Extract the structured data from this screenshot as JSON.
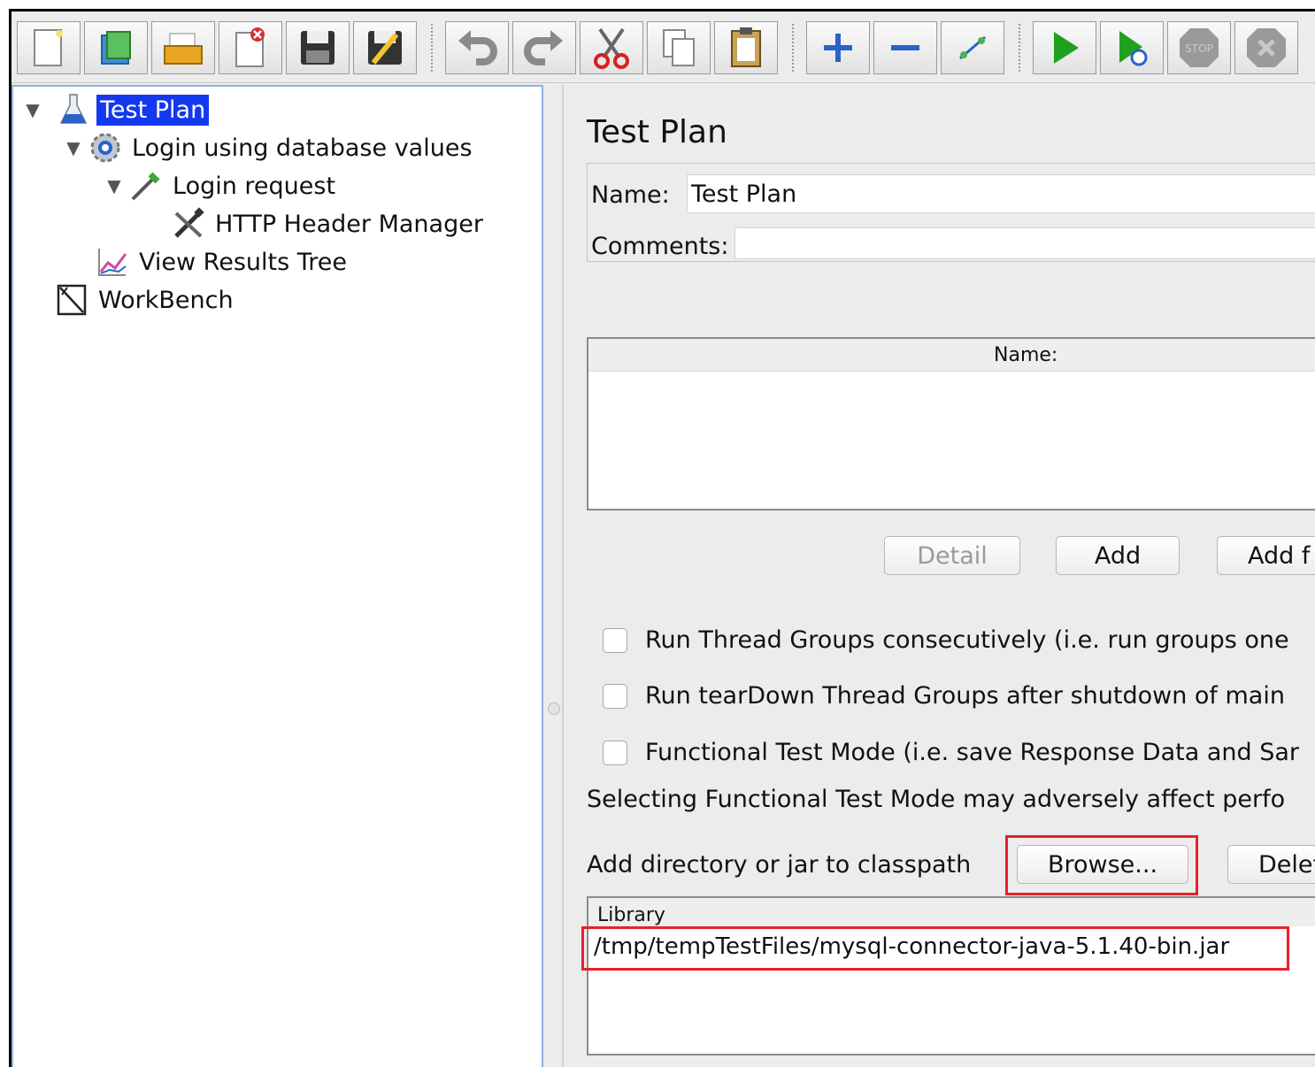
{
  "toolbar": {
    "groups": [
      [
        "new-icon",
        "templates-icon",
        "open-icon",
        "close-icon",
        "save-icon",
        "save-as-icon"
      ],
      [
        "undo-icon",
        "redo-icon",
        "cut-icon",
        "copy-icon",
        "paste-icon"
      ],
      [
        "expand-icon",
        "collapse-icon",
        "toggle-icon"
      ],
      [
        "start-icon",
        "start-no-pauses-icon",
        "stop-icon",
        "shutdown-icon"
      ]
    ]
  },
  "tree": {
    "items": [
      {
        "label": "Test Plan",
        "icon": "flask-icon",
        "expanded": true,
        "selected": true
      },
      {
        "label": "Login using database values",
        "icon": "gear-icon",
        "expanded": true
      },
      {
        "label": "Login request",
        "icon": "pipette-icon",
        "expanded": true
      },
      {
        "label": "HTTP Header Manager",
        "icon": "tools-icon"
      },
      {
        "label": "View Results Tree",
        "icon": "graph-icon"
      },
      {
        "label": "WorkBench",
        "icon": "workbench-icon"
      }
    ]
  },
  "panel": {
    "title": "Test Plan",
    "name_label": "Name:",
    "name_value": "Test Plan",
    "comments_label": "Comments:",
    "comments_value": "",
    "variables_header": "Name:",
    "buttons": {
      "detail": "Detail",
      "add": "Add",
      "add_from_clipboard": "Add f"
    },
    "checkboxes": [
      {
        "label": "Run Thread Groups consecutively (i.e. run groups one",
        "checked": false
      },
      {
        "label": "Run tearDown Thread Groups after shutdown of main",
        "checked": false
      },
      {
        "label": "Functional Test Mode (i.e. save Response Data and Sar",
        "checked": false
      }
    ],
    "functional_warning": "Selecting Functional Test Mode may adversely affect perfo",
    "classpath_label": "Add directory or jar to classpath",
    "browse_button": "Browse...",
    "delete_button": "Delet",
    "library_header": "Library",
    "library_rows": [
      "/tmp/tempTestFiles/mysql-connector-java-5.1.40-bin.jar"
    ]
  },
  "colors": {
    "selection": "#1338f0",
    "highlight": "#e8202a",
    "tree_border": "#8fb1de",
    "run_green": "#1fa11f"
  }
}
